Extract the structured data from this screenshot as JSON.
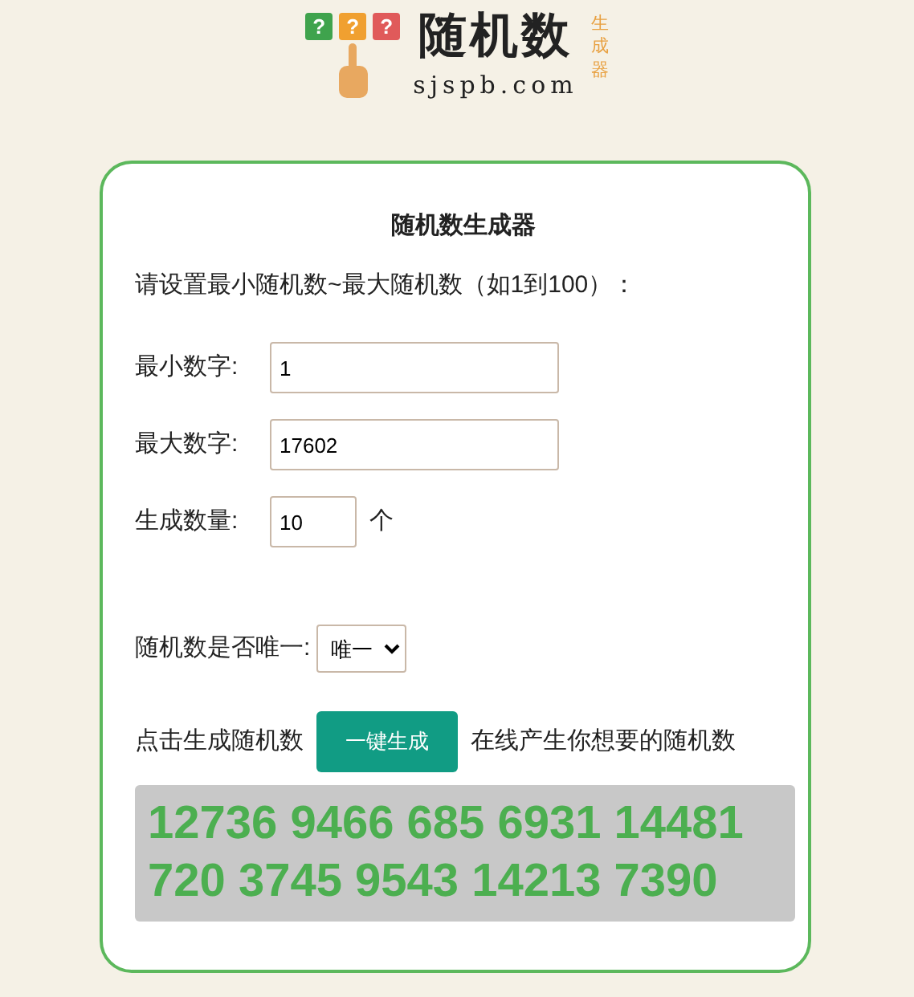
{
  "logo": {
    "marks": [
      {
        "text": "?",
        "color": "#3fa34d"
      },
      {
        "text": "?",
        "color": "#f0a030"
      },
      {
        "text": "?",
        "color": "#e05a5a"
      }
    ],
    "title": "随机数",
    "domain": "sjspb.com",
    "side_text": "生成器"
  },
  "card": {
    "title": "随机数生成器",
    "instruction": "请设置最小随机数~最大随机数（如1到100）：",
    "fields": [
      {
        "label": "最小数字:",
        "value": "1",
        "kind": "wide"
      },
      {
        "label": "最大数字:",
        "value": "17602",
        "kind": "wide"
      },
      {
        "label": "生成数量:",
        "value": "10",
        "kind": "short",
        "unit": "个"
      }
    ],
    "unique": {
      "label": "随机数是否唯一:",
      "value": "唯一"
    },
    "action": {
      "before": "点击生成随机数",
      "button": "一键生成",
      "after": "在线产生你想要的随机数"
    },
    "result": "12736 9466 685 6931 14481 720 3745 9543 14213 7390"
  }
}
